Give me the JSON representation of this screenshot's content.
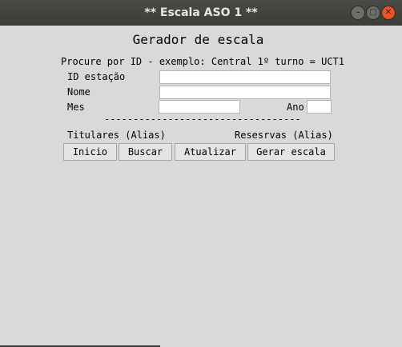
{
  "window": {
    "title": "** Escala ASO 1 **"
  },
  "form": {
    "heading": "Gerador de escala",
    "instructions": "Procure por ID - exemplo: Central 1º turno = UCT1",
    "id_label": "ID estação",
    "id_value": "",
    "nome_label": "Nome",
    "nome_value": "",
    "mes_label": "Mes",
    "mes_value": "",
    "ano_label": "Ano",
    "ano_value": "",
    "separator": "----------------------------------",
    "titulares_label": "Titulares (Alias)",
    "reservas_label": "Resesrvas (Alias)"
  },
  "buttons": {
    "inicio": "Inicio",
    "buscar": "Buscar",
    "atualizar": "Atualizar",
    "gerar": "Gerar escala"
  }
}
